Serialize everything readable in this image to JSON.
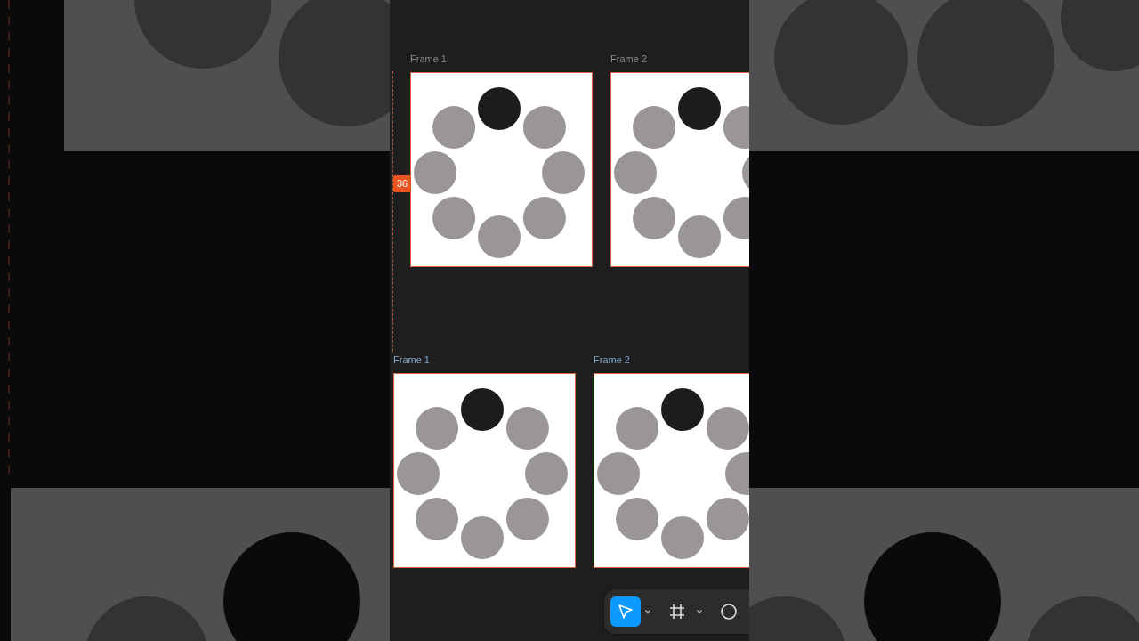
{
  "canvas": {
    "measure_badge": "36",
    "rows": [
      {
        "frames": [
          {
            "label": "Frame 1",
            "selected": false,
            "dots": [
              {
                "color": "#1c1c1c"
              },
              {
                "color": "#9a9696"
              },
              {
                "color": "#9a9696"
              },
              {
                "color": "#9a9696"
              },
              {
                "color": "#9a9696"
              },
              {
                "color": "#9a9696"
              },
              {
                "color": "#9a9696"
              },
              {
                "color": "#9a9696"
              }
            ]
          },
          {
            "label": "Frame 2",
            "selected": false,
            "dots": [
              {
                "color": "#1c1c1c"
              },
              {
                "color": "#9a9696"
              },
              {
                "color": "#9a9696"
              },
              {
                "color": "#9a9696"
              },
              {
                "color": "#9a9696"
              },
              {
                "color": "#9a9696"
              },
              {
                "color": "#9a9696"
              },
              {
                "color": "#9a9696"
              }
            ]
          }
        ]
      },
      {
        "frames": [
          {
            "label": "Frame 1",
            "selected": true,
            "dots": [
              {
                "color": "#1c1c1c"
              },
              {
                "color": "#9a9696"
              },
              {
                "color": "#9a9696"
              },
              {
                "color": "#9a9696"
              },
              {
                "color": "#9a9696"
              },
              {
                "color": "#9a9696"
              },
              {
                "color": "#9a9696"
              },
              {
                "color": "#9a9696"
              }
            ]
          },
          {
            "label": "Frame 2",
            "selected": true,
            "dots": [
              {
                "color": "#1c1c1c"
              },
              {
                "color": "#9a9696"
              },
              {
                "color": "#9a9696"
              },
              {
                "color": "#9a9696"
              },
              {
                "color": "#9a9696"
              },
              {
                "color": "#9a9696"
              },
              {
                "color": "#9a9696"
              },
              {
                "color": "#9a9696"
              }
            ]
          }
        ]
      }
    ]
  },
  "toolbar": {
    "tools": [
      {
        "kind": "move",
        "selected": true,
        "has_menu": true
      },
      {
        "kind": "frame",
        "selected": false,
        "has_menu": true
      },
      {
        "kind": "ellipse",
        "selected": false,
        "has_menu": false
      }
    ]
  }
}
